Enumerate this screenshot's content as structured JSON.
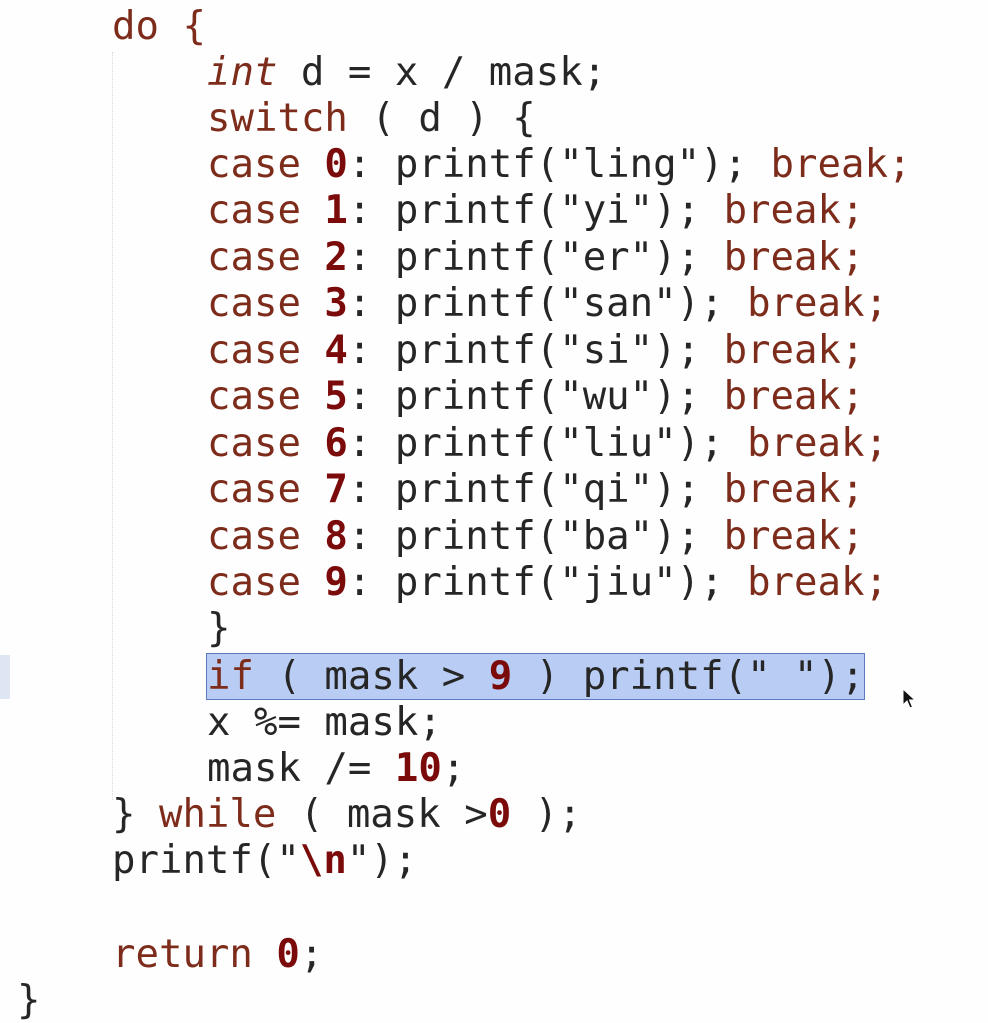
{
  "code": {
    "l1_do": "do {",
    "l2_type": "int",
    "l2_rest": " d = x / mask;",
    "l3_switch": "switch",
    "l3_rest": " ( d ) {",
    "cases": [
      {
        "kw": "case",
        "num": "0",
        "call": ": printf(\"ling\"); ",
        "brk": "break;"
      },
      {
        "kw": "case",
        "num": "1",
        "call": ": printf(\"yi\"); ",
        "brk": "break;"
      },
      {
        "kw": "case",
        "num": "2",
        "call": ": printf(\"er\"); ",
        "brk": "break;"
      },
      {
        "kw": "case",
        "num": "3",
        "call": ": printf(\"san\"); ",
        "brk": "break;"
      },
      {
        "kw": "case",
        "num": "4",
        "call": ": printf(\"si\"); ",
        "brk": "break;"
      },
      {
        "kw": "case",
        "num": "5",
        "call": ": printf(\"wu\"); ",
        "brk": "break;"
      },
      {
        "kw": "case",
        "num": "6",
        "call": ": printf(\"liu\"); ",
        "brk": "break;"
      },
      {
        "kw": "case",
        "num": "7",
        "call": ": printf(\"qi\"); ",
        "brk": "break;"
      },
      {
        "kw": "case",
        "num": "8",
        "call": ": printf(\"ba\"); ",
        "brk": "break;"
      },
      {
        "kw": "case",
        "num": "9",
        "call": ": printf(\"jiu\"); ",
        "brk": "break;"
      }
    ],
    "close_switch": "}",
    "if_kw": "if",
    "if_cond": " ( mask > ",
    "if_num": "9",
    "if_rest": " ) printf(\" \");",
    "mod_line": "x %= mask;",
    "div_pre": "mask /= ",
    "div_num": "10",
    "div_end": ";",
    "while_brace": "} ",
    "while_kw": "while",
    "while_cond": " ( mask >",
    "while_num": "0",
    "while_end": " );",
    "printf_pre": "printf(\"",
    "printf_esc": "\\n",
    "printf_end": "\");",
    "return_kw": "return",
    "return_sp": " ",
    "return_num": "0",
    "return_end": ";",
    "close_func": "}"
  },
  "colors": {
    "keyword": "#7d2c1b",
    "number": "#7b0a0a",
    "selection": "#b9cdf4",
    "text": "#262626"
  },
  "icons": {
    "cursor": "mouse-pointer-icon"
  }
}
